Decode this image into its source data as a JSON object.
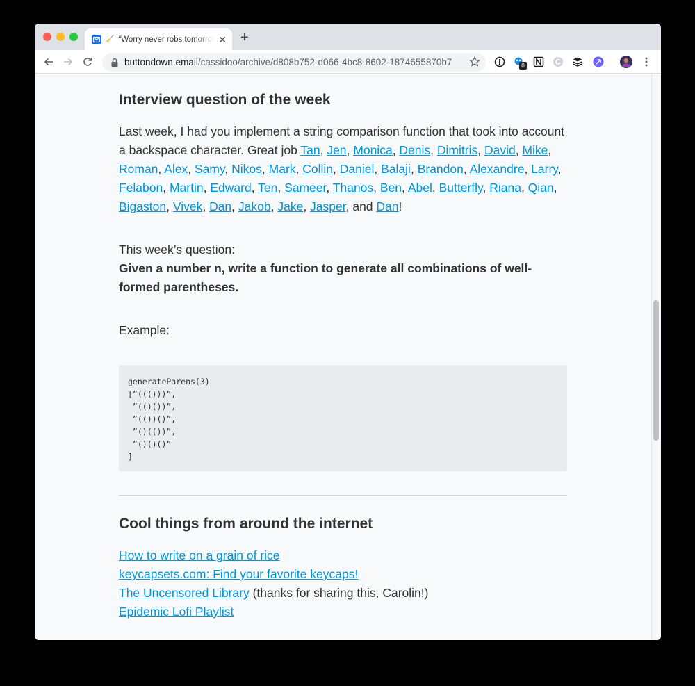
{
  "browser": {
    "tab_title": "“Worry never robs tomorrow of its sorrow...",
    "tab_emoji": "🧹",
    "url_domain": "buttondown.email",
    "url_path": "/cassidoo/archive/d808b752-d066-4bc8-8602-1874655870b7",
    "extension_badge": "0",
    "colors": {
      "accent_link": "#0094d9",
      "tab_strip": "#dee1e6",
      "page_bg": "#f8f9fa"
    }
  },
  "article": {
    "interview_heading": "Interview question of the week",
    "intro_text": "Last week, I had you implement a string comparison function that took into account a backspace character. Great job ",
    "names": [
      "Tan",
      "Jen",
      "Monica",
      "Denis",
      "Dimitris",
      "David",
      "Mike",
      "Roman",
      "Alex",
      "Samy",
      "Nikos",
      "Mark",
      "Collin",
      "Daniel",
      "Balaji",
      "Brandon",
      "Alexandre",
      "Larry",
      "Felabon",
      "Martin",
      "Edward",
      "Ten",
      "Sameer",
      "Thanos",
      "Ben",
      "Abel",
      "Butterfly",
      "Riana",
      "Qian",
      "Bigaston",
      "Vivek",
      "Dan",
      "Jakob",
      "Jake",
      "Jasper"
    ],
    "and_text": ", and ",
    "last_name": "Dan",
    "end_punct": "!",
    "question_label": "This week’s question:",
    "question_text": "Given a number n, write a function to generate all combinations of well-formed parentheses.",
    "example_label": "Example:",
    "code_block": "generateParens(3)\n[”((()))”,\n ”(()())”,\n ”(())()”,\n ”()(())”,\n ”()()()”\n]",
    "cool_heading": "Cool things from around the internet",
    "links": [
      {
        "text": "How to write on a grain of rice",
        "suffix": ""
      },
      {
        "text": "keycapsets.com: Find your favorite keycaps!",
        "suffix": ""
      },
      {
        "text": "The Uncensored Library",
        "suffix": " (thanks for sharing this, Carolin!)"
      },
      {
        "text": "Epidemic Lofi Playlist",
        "suffix": ""
      }
    ]
  }
}
